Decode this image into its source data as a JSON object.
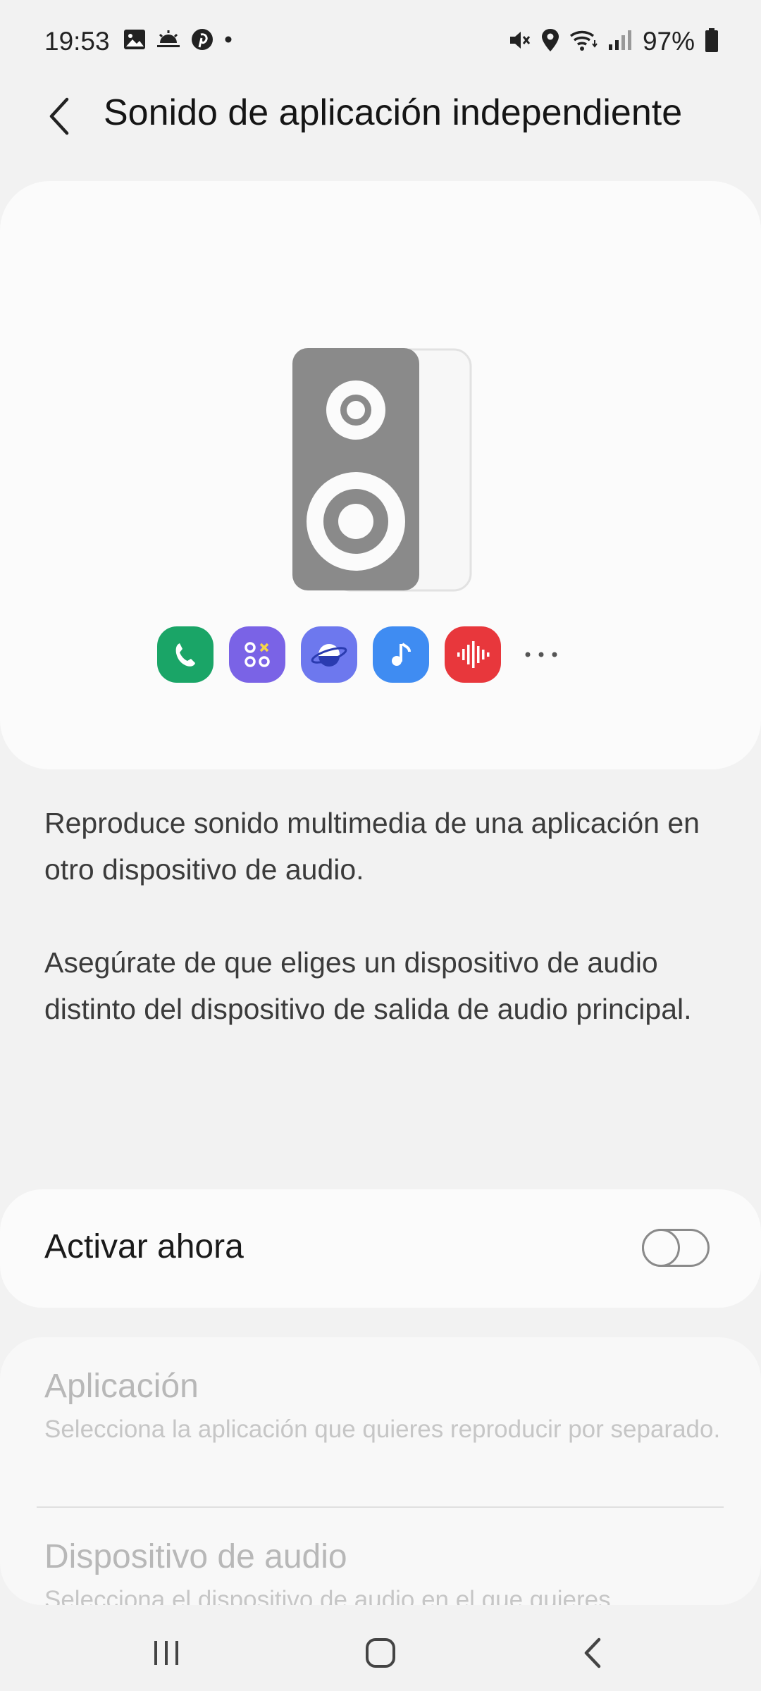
{
  "status_bar": {
    "time": "19:53",
    "battery": "97%",
    "icons": [
      "gallery-icon",
      "weather-icon",
      "pinterest-icon",
      "dot-icon",
      "mute-icon",
      "location-icon",
      "wifi-icon",
      "signal-icon",
      "battery-icon"
    ]
  },
  "header": {
    "title": "Sonido de aplicación independiente"
  },
  "hero": {
    "apps": [
      "phone-app-icon",
      "game-launcher-icon",
      "internet-browser-icon",
      "music-app-icon",
      "voice-recorder-icon"
    ],
    "app_colors": [
      "#1aa567",
      "#7a63e6",
      "#6d78ee",
      "#3f8cf2",
      "#e8373c"
    ]
  },
  "description": {
    "p1": "Reproduce sonido multimedia de una aplicación en otro dispositivo de audio.",
    "p2": "Asegúrate de que eliges un dispositivo de audio distinto del dispositivo de salida de audio principal."
  },
  "toggle": {
    "label": "Activar ahora",
    "state": "off"
  },
  "settings": [
    {
      "title": "Aplicación",
      "subtitle": "Selecciona la aplicación que quieres reproducir por separado."
    },
    {
      "title": "Dispositivo de audio",
      "subtitle": "Selecciona el dispositivo de audio en el que quieres"
    }
  ]
}
